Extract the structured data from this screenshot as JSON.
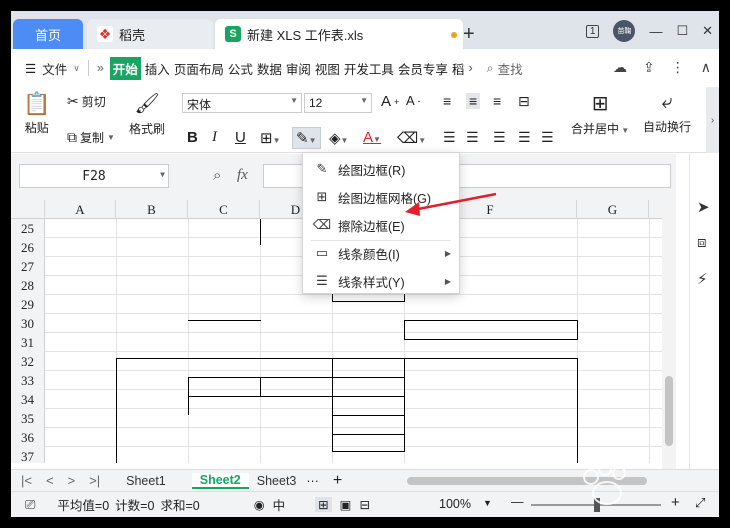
{
  "tabs": {
    "home": "首页",
    "daoke": "稻壳",
    "doc": "新建 XLS 工作表.xls"
  },
  "titlebar": {
    "badge": "1",
    "avatar": "苗鞠"
  },
  "menu": {
    "file": "文件",
    "items": [
      "开始",
      "插入",
      "页面布局",
      "公式",
      "数据",
      "审阅",
      "视图",
      "开发工具",
      "会员专享",
      "稻"
    ],
    "search": "查找"
  },
  "ribbon": {
    "paste": "粘贴",
    "cut": "剪切",
    "copy": "复制",
    "format_painter": "格式刷",
    "font_name": "宋体",
    "font_size": "12",
    "merge_center": "合并居中",
    "auto_wrap": "自动换行"
  },
  "formula": {
    "cell_ref": "F28",
    "fx": "fx"
  },
  "columns": [
    "A",
    "B",
    "C",
    "D",
    "E",
    "F",
    "G"
  ],
  "rows": [
    "25",
    "26",
    "27",
    "28",
    "29",
    "30",
    "31",
    "32",
    "33",
    "34",
    "35",
    "36",
    "37"
  ],
  "border_menu": {
    "items": [
      {
        "label": "绘图边框(R)",
        "submenu": false
      },
      {
        "label": "绘图边框网格(G)",
        "submenu": false
      },
      {
        "label": "擦除边框(E)",
        "submenu": false
      },
      {
        "label": "线条颜色(I)",
        "submenu": true
      },
      {
        "label": "线条样式(Y)",
        "submenu": true
      }
    ]
  },
  "sheets": [
    "Sheet1",
    "Sheet2",
    "Sheet3"
  ],
  "active_sheet": "Sheet2",
  "status": {
    "average": "平均值=0",
    "count": "计数=0",
    "sum": "求和=0",
    "zoom": "100%",
    "lang": "中"
  },
  "colors": {
    "accent_green": "#1aa462",
    "home_tab_blue": "#4d8bf5",
    "annotation_red": "#e0202a"
  }
}
